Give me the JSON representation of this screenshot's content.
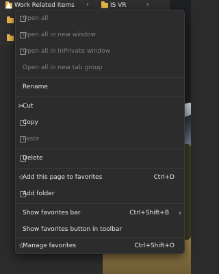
{
  "favorites_bar": {
    "folder_work": "Work Related Items",
    "folder_is": "IS VR"
  },
  "menu": {
    "items": [
      {
        "label": "Open all",
        "disabled": true
      },
      {
        "label": "Open all in new window",
        "disabled": true
      },
      {
        "label": "Open all in InPrivate window",
        "disabled": true
      },
      {
        "label": "Open all in new tab group",
        "disabled": true
      },
      {
        "label": "Rename",
        "disabled": false
      },
      {
        "label": "Cut",
        "disabled": false
      },
      {
        "label": "Copy",
        "disabled": false
      },
      {
        "label": "Paste",
        "disabled": true
      },
      {
        "label": "Delete",
        "disabled": false
      },
      {
        "label": "Add this page to favorites",
        "shortcut": "Ctrl+D",
        "disabled": false
      },
      {
        "label": "Add folder",
        "disabled": false
      },
      {
        "label": "Show favorites bar",
        "shortcut": "Ctrl+Shift+B",
        "disabled": false
      },
      {
        "label": "Show favorites button in toolbar",
        "disabled": false
      },
      {
        "label": "Manage favorites",
        "shortcut": "Ctrl+Shift+O",
        "disabled": false
      }
    ]
  },
  "colors": {
    "menu_bg": "#2c2c2c",
    "text": "#e6e6e6",
    "disabled_text": "#7e7e7e",
    "folder": "#e8b54a"
  }
}
